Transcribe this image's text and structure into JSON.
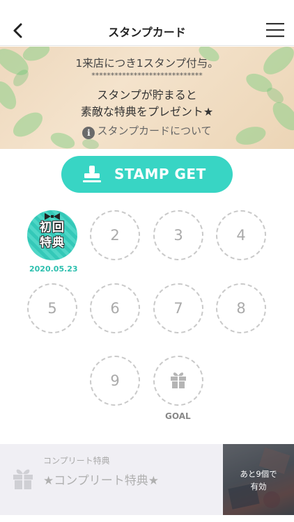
{
  "nav": {
    "title": "スタンプカード",
    "back_icon": "chevron-left-icon",
    "menu_icon": "hamburger-menu-icon"
  },
  "banner": {
    "line1": "1来店につき1スタンプ付与。",
    "stars": "*****************************",
    "line2": "スタンプが貯まると",
    "line3": "素敵な特典をプレゼント★",
    "info_link": "スタンプカードについて"
  },
  "stamp_button": {
    "label": "STAMP GET",
    "icon": "stamp-icon",
    "color": "#38d5c4"
  },
  "stamps": {
    "first": {
      "line1": "初回",
      "line2": "特典",
      "date": "2020.05.23"
    },
    "slots": [
      "2",
      "3",
      "4",
      "5",
      "6",
      "7",
      "8",
      "9"
    ],
    "goal_label": "GOAL",
    "goal_icon": "gift-icon"
  },
  "footer": {
    "subtitle": "コンプリート特典",
    "title": "★コンプリート特典★",
    "badge_line1": "あと9個で",
    "badge_line2": "有効",
    "icon": "gift-icon"
  }
}
